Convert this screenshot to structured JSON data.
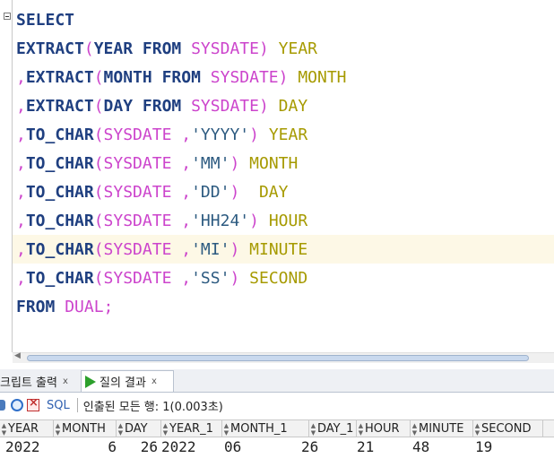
{
  "editor": {
    "lines": [
      [
        {
          "t": "SELECT",
          "c": "kw"
        }
      ],
      [
        {
          "t": "EXTRACT",
          "c": "kw"
        },
        {
          "t": "(",
          "c": "pn"
        },
        {
          "t": "YEAR",
          "c": "kw"
        },
        {
          "t": " FROM ",
          "c": "kw"
        },
        {
          "t": "SYSDATE",
          "c": "fn"
        },
        {
          "t": ") ",
          "c": "pn"
        },
        {
          "t": "YEAR",
          "c": "al"
        }
      ],
      [
        {
          "t": ",",
          "c": "pn"
        },
        {
          "t": "EXTRACT",
          "c": "kw"
        },
        {
          "t": "(",
          "c": "pn"
        },
        {
          "t": "MONTH",
          "c": "kw"
        },
        {
          "t": " FROM ",
          "c": "kw"
        },
        {
          "t": "SYSDATE",
          "c": "fn"
        },
        {
          "t": ") ",
          "c": "pn"
        },
        {
          "t": "MONTH",
          "c": "al"
        }
      ],
      [
        {
          "t": ",",
          "c": "pn"
        },
        {
          "t": "EXTRACT",
          "c": "kw"
        },
        {
          "t": "(",
          "c": "pn"
        },
        {
          "t": "DAY",
          "c": "kw"
        },
        {
          "t": " FROM ",
          "c": "kw"
        },
        {
          "t": "SYSDATE",
          "c": "fn"
        },
        {
          "t": ") ",
          "c": "pn"
        },
        {
          "t": "DAY",
          "c": "al"
        }
      ],
      [
        {
          "t": ",",
          "c": "pn"
        },
        {
          "t": "TO_CHAR",
          "c": "kw"
        },
        {
          "t": "(",
          "c": "pn"
        },
        {
          "t": "SYSDATE ,",
          "c": "fn"
        },
        {
          "t": "'YYYY'",
          "c": "str"
        },
        {
          "t": ") ",
          "c": "pn"
        },
        {
          "t": "YEAR",
          "c": "al"
        }
      ],
      [
        {
          "t": ",",
          "c": "pn"
        },
        {
          "t": "TO_CHAR",
          "c": "kw"
        },
        {
          "t": "(",
          "c": "pn"
        },
        {
          "t": "SYSDATE ,",
          "c": "fn"
        },
        {
          "t": "'MM'",
          "c": "str"
        },
        {
          "t": ") ",
          "c": "pn"
        },
        {
          "t": "MONTH",
          "c": "al"
        }
      ],
      [
        {
          "t": ",",
          "c": "pn"
        },
        {
          "t": "TO_CHAR",
          "c": "kw"
        },
        {
          "t": "(",
          "c": "pn"
        },
        {
          "t": "SYSDATE ,",
          "c": "fn"
        },
        {
          "t": "'DD'",
          "c": "str"
        },
        {
          "t": ")  ",
          "c": "pn"
        },
        {
          "t": "DAY",
          "c": "al"
        }
      ],
      [
        {
          "t": ",",
          "c": "pn"
        },
        {
          "t": "TO_CHAR",
          "c": "kw"
        },
        {
          "t": "(",
          "c": "pn"
        },
        {
          "t": "SYSDATE ,",
          "c": "fn"
        },
        {
          "t": "'HH24'",
          "c": "str"
        },
        {
          "t": ") ",
          "c": "pn"
        },
        {
          "t": "HOUR",
          "c": "al"
        }
      ],
      [
        {
          "t": ",",
          "c": "pn"
        },
        {
          "t": "TO_CHAR",
          "c": "kw"
        },
        {
          "t": "(",
          "c": "pn"
        },
        {
          "t": "SYSDATE ,",
          "c": "fn"
        },
        {
          "t": "'MI'",
          "c": "str"
        },
        {
          "t": ") ",
          "c": "pn"
        },
        {
          "t": "MINUTE",
          "c": "al"
        }
      ],
      [
        {
          "t": ",",
          "c": "pn"
        },
        {
          "t": "TO_CHAR",
          "c": "kw"
        },
        {
          "t": "(",
          "c": "pn"
        },
        {
          "t": "SYSDATE ,",
          "c": "fn"
        },
        {
          "t": "'SS'",
          "c": "str"
        },
        {
          "t": ") ",
          "c": "pn"
        },
        {
          "t": "SECOND",
          "c": "al"
        }
      ],
      [
        {
          "t": "FROM ",
          "c": "kw"
        },
        {
          "t": "DUAL;",
          "c": "fn"
        }
      ]
    ]
  },
  "tabs": {
    "script_output": "크립트 출력",
    "script_output_close": "x",
    "query_result": "질의 결과",
    "query_result_close": "x"
  },
  "toolbar": {
    "sql_label": "SQL",
    "status": "인출된 모든 행: 1(0.003초)"
  },
  "grid": {
    "columns": [
      "YEAR",
      "MONTH",
      "DAY",
      "YEAR_1",
      "MONTH_1",
      "DAY_1",
      "HOUR",
      "MINUTE",
      "SECOND"
    ],
    "row": [
      "2022",
      "6",
      "26",
      "2022",
      "06",
      "26",
      "21",
      "48",
      "19"
    ]
  },
  "colors": {
    "keyword": "#1f3f80",
    "function": "#cc44cc",
    "string": "#2c5a80",
    "alias": "#a69a00",
    "current_line": "#fdf8e6",
    "run_icon": "#2ca02c"
  }
}
